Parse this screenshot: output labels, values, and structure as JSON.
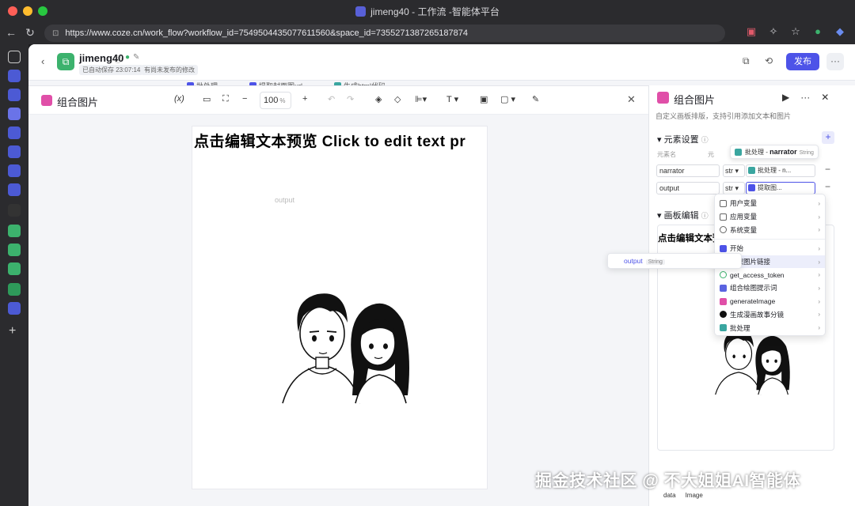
{
  "window": {
    "title": "jimeng40 - 工作流 -智能体平台"
  },
  "browser": {
    "url": "https://www.coze.cn/work_flow?workflow_id=7549504435077611560&space_id=7355271387265187874"
  },
  "header": {
    "app_name": "jimeng40",
    "saved_status": "已自动保存 23:07:14",
    "unpublished": "有尚未发布的修改",
    "publish_label": "发布",
    "more_label": "···"
  },
  "bg_nodes": [
    "批处理",
    "提取封面图url",
    "生成html代码"
  ],
  "canvas": {
    "title": "组合图片",
    "var_button": "(x)",
    "zoom": "100",
    "zoom_unit": "%",
    "artboard_text": "点击编辑文本预览 Click to edit text pr",
    "placeholder_label": "output"
  },
  "panel": {
    "title": "组合图片",
    "description": "自定义画板排版，支持引用添加文本和图片",
    "elements_section": "元素设置",
    "col_name": "元素名",
    "col_value": "元",
    "tooltip": {
      "prefix": "批处理 -",
      "name": "narrator",
      "type": "String"
    },
    "params": [
      {
        "name": "narrator",
        "type": "str",
        "value": "批处理 - n..."
      },
      {
        "name": "output",
        "type": "str",
        "value": "提取图..."
      }
    ],
    "canvas_section": "画板编辑",
    "preview_text": "点击编辑文本预览 Click to edit text p",
    "bottom_labels": [
      "data",
      "Image"
    ]
  },
  "dropdown": {
    "groups": [
      "用户变量",
      "应用变量",
      "系统变量"
    ],
    "nodes": [
      "开始",
      "提取图片链接",
      "get_access_token",
      "组合绘图提示词",
      "generateImage",
      "生成漫画故事分镜",
      "批处理"
    ]
  },
  "subpopup": {
    "name": "output",
    "type": "String"
  },
  "watermark": "掘金技术社区 @ 不大姐姐AI智能体",
  "colors": {
    "accent": "#4d53e8",
    "node_teal": "#3aa6a0",
    "pink": "#e04fa8",
    "green": "#3cb26d"
  }
}
